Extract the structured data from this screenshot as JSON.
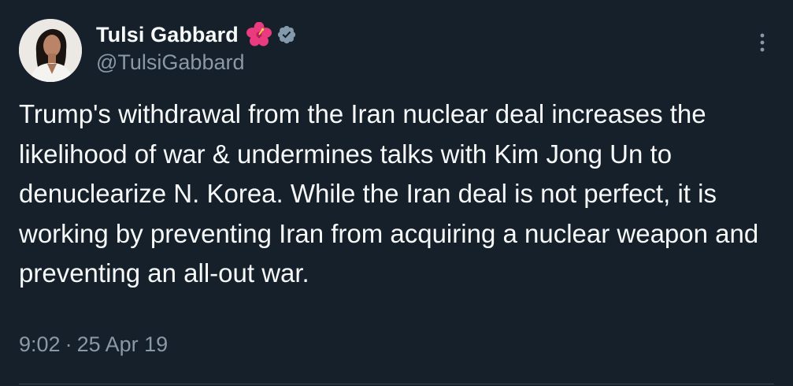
{
  "author": {
    "display_name": "Tulsi Gabbard",
    "handle": "@TulsiGabbard",
    "name_emoji": "hibiscus-icon",
    "verified": true,
    "avatar": "avatar-photo"
  },
  "tweet": {
    "text": "Trump's withdrawal from the Iran nuclear deal increases the likelihood of war & undermines talks with Kim Jong Un to denuclearize N. Korea. While the Iran deal is not perfect, it is working by preventing Iran from acquiring a nuclear weapon and preventing an all-out war.",
    "time": "9:02",
    "separator": "·",
    "date": "25 Apr 19"
  },
  "icons": {
    "verified": "verified-badge-icon",
    "more": "more-options-icon"
  },
  "colors": {
    "background": "#15202b",
    "text_primary": "#f7f9f9",
    "text_secondary": "#8b98a5",
    "verified_badge": "#829aab"
  }
}
